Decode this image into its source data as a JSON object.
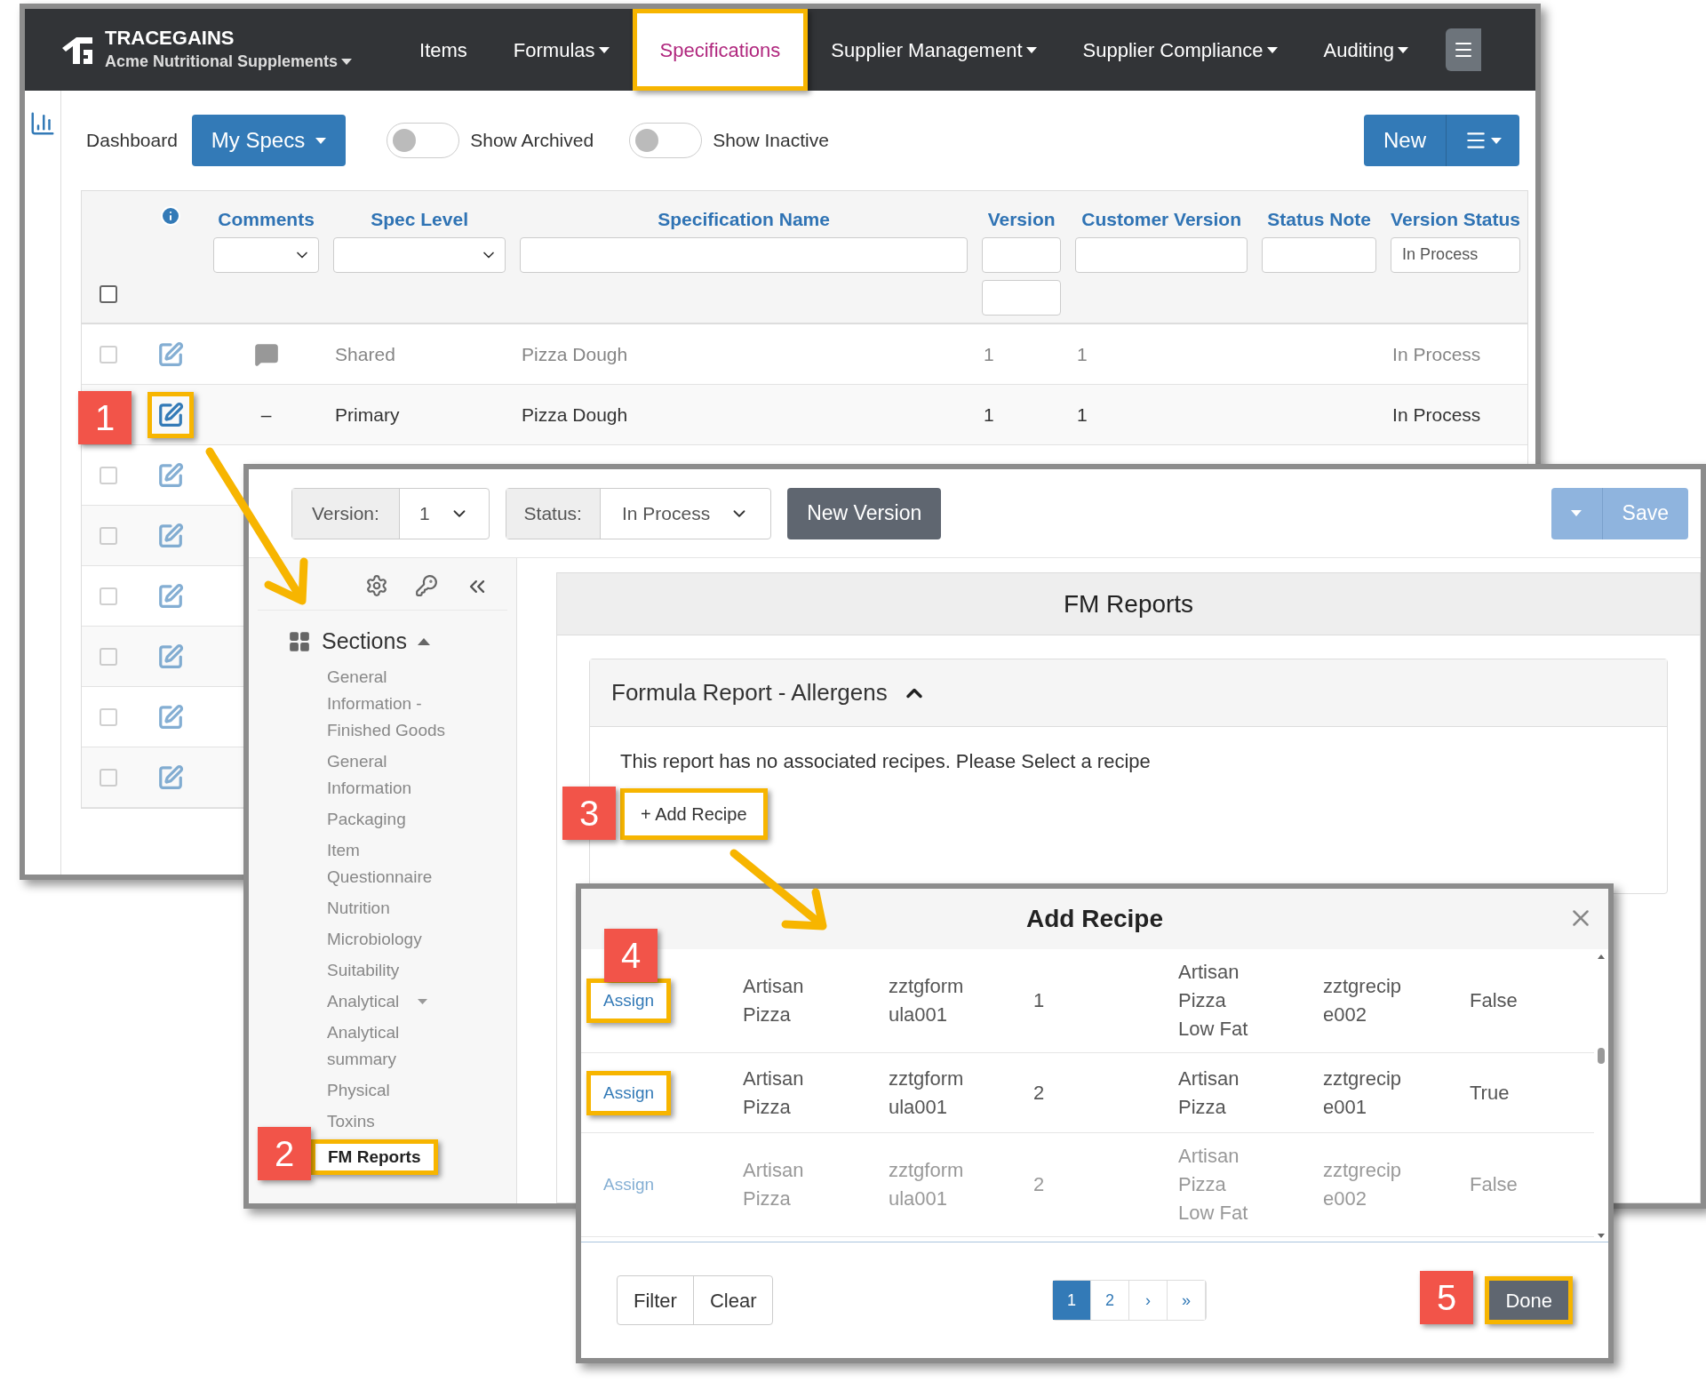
{
  "app": {
    "brand": "TRACEGAINS",
    "account": "Acme Nutritional Supplements"
  },
  "nav": [
    {
      "label": "Items",
      "dropdown": false,
      "selected": false,
      "highlighted": false
    },
    {
      "label": "Formulas",
      "dropdown": true,
      "selected": false,
      "highlighted": false
    },
    {
      "label": "Specifications",
      "dropdown": false,
      "selected": true,
      "highlighted": true
    },
    {
      "label": "Supplier Management",
      "dropdown": true,
      "selected": false,
      "highlighted": false
    },
    {
      "label": "Supplier Compliance",
      "dropdown": true,
      "selected": false,
      "highlighted": false
    },
    {
      "label": "Auditing",
      "dropdown": true,
      "selected": false,
      "highlighted": false
    }
  ],
  "toolbar": {
    "dashboard": "Dashboard",
    "view": "My Specs",
    "toggles": [
      {
        "label": "Show Archived",
        "on": false
      },
      {
        "label": "Show Inactive",
        "on": false
      }
    ],
    "new": "New"
  },
  "table": {
    "select_all": false,
    "columns": [
      {
        "label": "Comments",
        "kind": "select"
      },
      {
        "label": "Spec Level",
        "kind": "select"
      },
      {
        "label": "Specification Name",
        "kind": "text"
      },
      {
        "label": "Version",
        "kind": "range"
      },
      {
        "label": "Customer Version",
        "kind": "text"
      },
      {
        "label": "Status Note",
        "kind": "text"
      },
      {
        "label": "Version Status",
        "kind": "text",
        "value": "In Process"
      }
    ],
    "rows": [
      {
        "kind": "full",
        "blurred": true,
        "checked": false,
        "highlighted": false,
        "comment": {
          "kind": "icon"
        },
        "spec_level": "Shared",
        "name": "Pizza Dough",
        "version": "1",
        "customer_version": "1",
        "version_status": "In Process"
      },
      {
        "kind": "full",
        "blurred": false,
        "highlighted": true,
        "comment": {
          "kind": "text",
          "text": "–"
        },
        "spec_level": "Primary",
        "name": "Pizza Dough",
        "version": "1",
        "customer_version": "1",
        "version_status": "In Process"
      },
      {
        "kind": "icons_only",
        "blurred": true,
        "checked": false,
        "highlighted": false
      },
      {
        "kind": "icons_only",
        "blurred": true,
        "checked": false,
        "highlighted": false
      },
      {
        "kind": "icons_only",
        "blurred": true,
        "checked": false,
        "highlighted": false
      },
      {
        "kind": "icons_only",
        "blurred": true,
        "checked": false,
        "highlighted": false
      },
      {
        "kind": "icons_only",
        "blurred": true,
        "checked": false,
        "highlighted": false
      },
      {
        "kind": "icons_only",
        "blurred": true,
        "checked": false,
        "highlighted": false
      }
    ]
  },
  "editor": {
    "version_label": "Version:",
    "version": "1",
    "status_label": "Status:",
    "status": "In Process",
    "new_version": "New Version",
    "save": "Save",
    "sections_title": "Sections",
    "sections_expanded": true,
    "sections": [
      {
        "label": "General Information - Finished Goods",
        "blurred": true,
        "highlighted": false,
        "expandable": false
      },
      {
        "label": "General Information",
        "blurred": true,
        "highlighted": false,
        "expandable": false
      },
      {
        "label": "Packaging",
        "blurred": true,
        "highlighted": false,
        "expandable": false
      },
      {
        "label": "Item Questionnaire",
        "blurred": true,
        "highlighted": false,
        "expandable": false
      },
      {
        "label": "Nutrition",
        "blurred": true,
        "highlighted": false,
        "expandable": false
      },
      {
        "label": "Microbiology",
        "blurred": true,
        "highlighted": false,
        "expandable": false
      },
      {
        "label": "Suitability",
        "blurred": true,
        "highlighted": false,
        "expandable": false
      },
      {
        "label": "Analytical",
        "blurred": true,
        "highlighted": false,
        "expandable": true
      },
      {
        "label": "Analytical summary",
        "blurred": true,
        "highlighted": false,
        "expandable": false
      },
      {
        "label": "Physical",
        "blurred": true,
        "highlighted": false,
        "expandable": false
      },
      {
        "label": "Toxins",
        "blurred": true,
        "highlighted": false,
        "expandable": false
      },
      {
        "label": "FM Reports",
        "blurred": false,
        "highlighted": true,
        "expandable": false
      }
    ],
    "panel_title": "FM Reports",
    "report": {
      "title": "Formula Report - Allergens",
      "expanded": true,
      "message": "This report has no associated recipes. Please Select a recipe",
      "add": "+ Add Recipe",
      "highlighted": true
    }
  },
  "modal": {
    "title": "Add Recipe",
    "rows": [
      {
        "action": "Assign",
        "blurred": false,
        "highlighted": true,
        "cells": [
          "Artisan Pizza",
          "zztgformula001",
          "1",
          "Artisan Pizza Low Fat",
          "zztgrecipe002",
          "False"
        ]
      },
      {
        "action": "Assign",
        "blurred": false,
        "highlighted": true,
        "cells": [
          "Artisan Pizza",
          "zztgformula001",
          "2",
          "Artisan Pizza",
          "zztgrecipe001",
          "True"
        ]
      },
      {
        "action": "Assign",
        "blurred": true,
        "highlighted": false,
        "cells": [
          "Artisan Pizza",
          "zztgformula001",
          "2",
          "Artisan Pizza Low Fat",
          "zztgrecipe002",
          "False"
        ]
      }
    ],
    "filter": "Filter",
    "clear": "Clear",
    "pages": [
      {
        "label": "1",
        "selected": true
      },
      {
        "label": "2",
        "selected": false
      },
      {
        "label": "›",
        "selected": false
      },
      {
        "label": "»",
        "selected": false
      }
    ],
    "done": "Done",
    "done_highlighted": true
  },
  "callouts": [
    "1",
    "2",
    "3",
    "4",
    "5"
  ]
}
